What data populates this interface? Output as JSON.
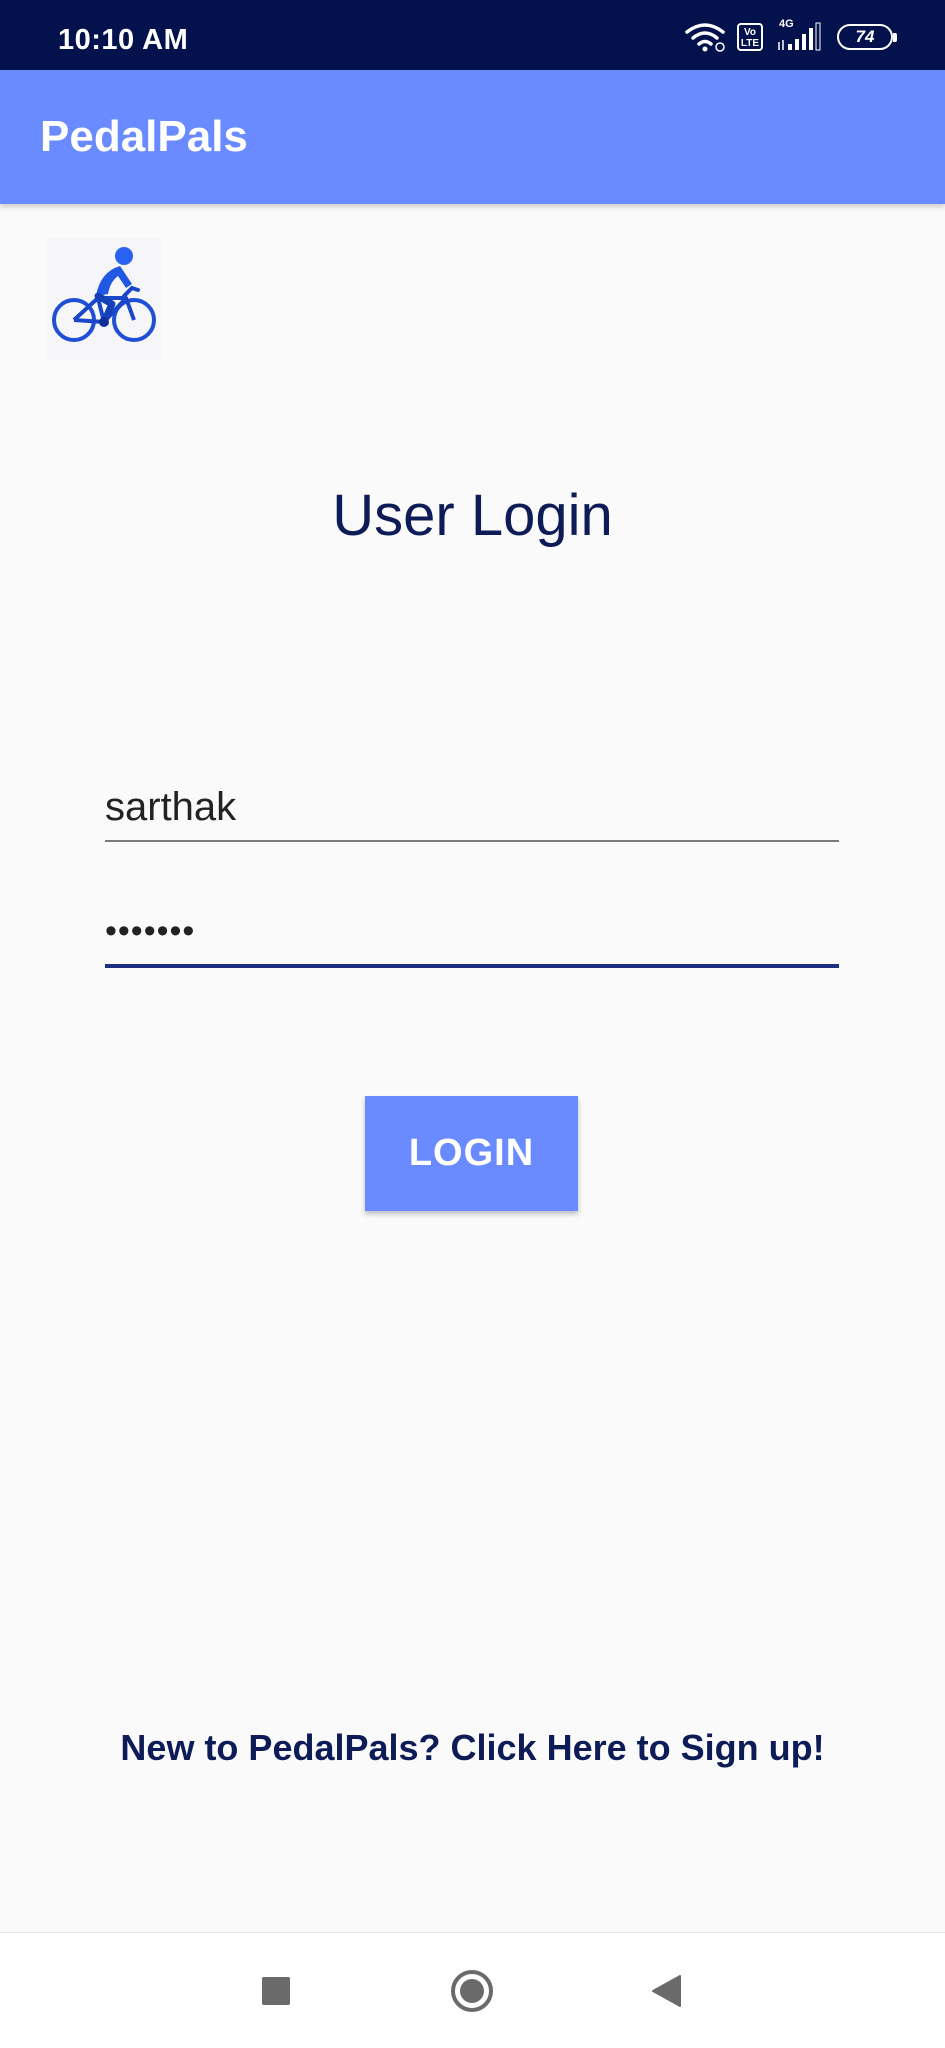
{
  "status_bar": {
    "time": "10:10 AM",
    "volte_label": "Vo\nLTE",
    "network_label": "4G",
    "battery_level": "74",
    "icons": [
      "wifi-icon",
      "volte-icon",
      "signal-icon",
      "battery-icon"
    ]
  },
  "app_bar": {
    "title": "PedalPals"
  },
  "logo": {
    "icon": "cyclist-logo-icon"
  },
  "login": {
    "heading": "User Login",
    "username_value": "sarthak",
    "password_masked": "•••••••",
    "button_label": "LOGIN"
  },
  "signup": {
    "link_text": "New to PedalPals? Click Here to Sign up!"
  },
  "nav_bar": {
    "icons": [
      "recents-square-icon",
      "home-circle-icon",
      "back-triangle-icon"
    ]
  },
  "colors": {
    "status_bar_bg": "#03124d",
    "app_bar_bg": "#6a8bff",
    "button_bg": "#6a8bff",
    "heading_text": "#0d1c56",
    "active_underline": "#1a2f80",
    "background": "#fafafa"
  }
}
